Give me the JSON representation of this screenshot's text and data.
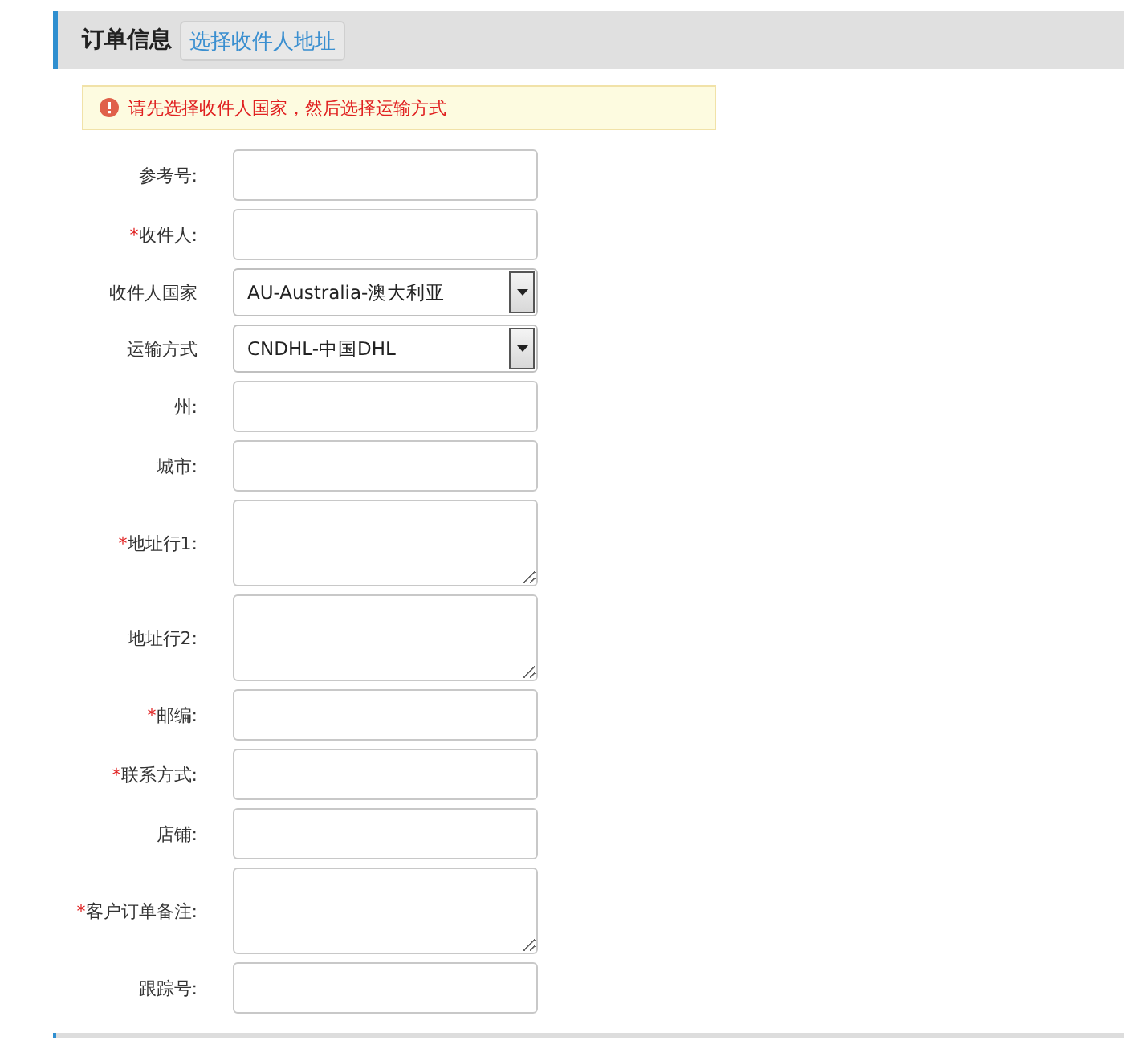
{
  "header": {
    "title": "订单信息",
    "button": "选择收件人地址"
  },
  "alert": {
    "text": "请先选择收件人国家，然后选择运输方式"
  },
  "fields": [
    {
      "kind": "text",
      "label": "参考号:"
    },
    {
      "kind": "text",
      "label": "收件人:",
      "mark": "*"
    },
    {
      "kind": "select",
      "label": "收件人国家",
      "value": "AU-Australia-澳大利亚"
    },
    {
      "kind": "select",
      "label": "运输方式",
      "value": "CNDHL-中国DHL"
    },
    {
      "kind": "text",
      "label": "州:"
    },
    {
      "kind": "text",
      "label": "城市:"
    },
    {
      "kind": "textarea",
      "label": "地址行1:",
      "mark": "*"
    },
    {
      "kind": "textarea",
      "label": "地址行2:"
    },
    {
      "kind": "text",
      "label": "邮编:",
      "mark": "*"
    },
    {
      "kind": "text",
      "label": "联系方式:",
      "mark": "*"
    },
    {
      "kind": "text",
      "label": "店铺:"
    },
    {
      "kind": "textarea",
      "label": "客户订单备注:",
      "mark": "*"
    },
    {
      "kind": "text",
      "label": "跟踪号:"
    }
  ]
}
